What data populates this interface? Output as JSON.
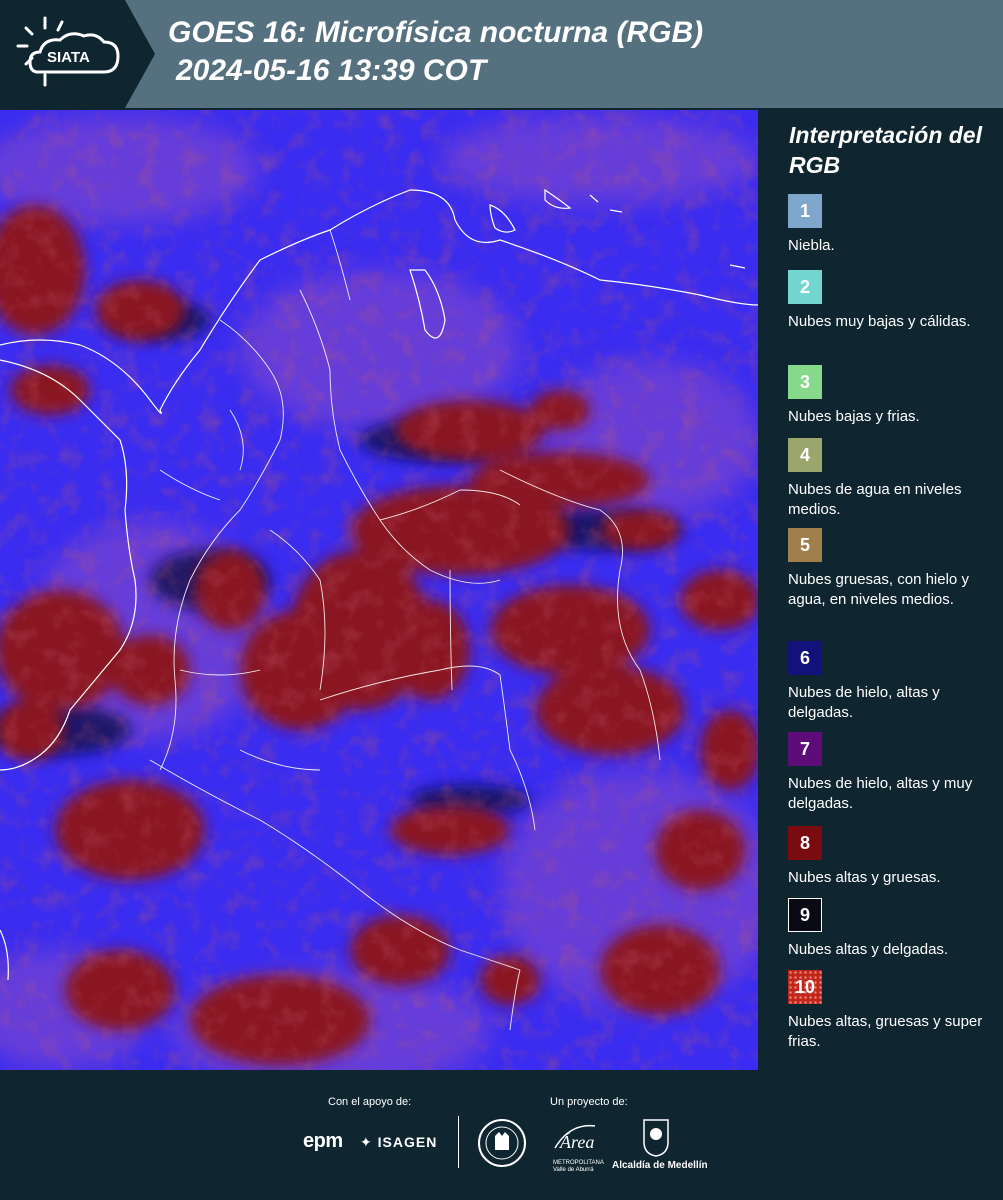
{
  "header": {
    "logo_text": "SIATA",
    "title_line1": "GOES 16: Microfísica nocturna (RGB)",
    "title_line2": "2024-05-16 13:39 COT"
  },
  "colors": {
    "header_bg": "#55707e",
    "page_bg": "#0f2530",
    "map_base": "#3a2cf0",
    "thick_cloud": "#8a1620",
    "thin_cloud_pink": "#8a4cc8"
  },
  "legend": {
    "title": "Interpretación del RGB",
    "items": [
      {
        "number": "1",
        "color": "#7fa7cc",
        "label": "Niebla."
      },
      {
        "number": "2",
        "color": "#74d6d0",
        "label": "Nubes muy bajas y cálidas."
      },
      {
        "number": "3",
        "color": "#86d98b",
        "label": "Nubes bajas y frias."
      },
      {
        "number": "4",
        "color": "#9aa66b",
        "label": "Nubes de agua en niveles medios."
      },
      {
        "number": "5",
        "color": "#a07f4a",
        "label": "Nubes gruesas, con hielo y agua, en niveles medios."
      },
      {
        "number": "6",
        "color": "#12127a",
        "label": "Nubes de hielo, altas y delgadas."
      },
      {
        "number": "7",
        "color": "#5d0c7a",
        "label": "Nubes de hielo, altas y muy delgadas."
      },
      {
        "number": "8",
        "color": "#7a0c10",
        "label": "Nubes altas y gruesas."
      },
      {
        "number": "9",
        "color": "#0a0a14",
        "label": "Nubes altas y delgadas."
      },
      {
        "number": "10",
        "color": "#c0271c",
        "label": "Nubes altas, gruesas y super frias."
      }
    ]
  },
  "footer": {
    "support_label": "Con el apoyo de:",
    "project_label": "Un proyecto de:",
    "epm_logo_text": "epm",
    "isagen_logo_text": "ISAGEN",
    "area_logo_text": "Área",
    "area_sub_text": "METROPOLITANA Valle de Aburrá",
    "medellin_logo_text": "Alcaldía de Medellín"
  }
}
